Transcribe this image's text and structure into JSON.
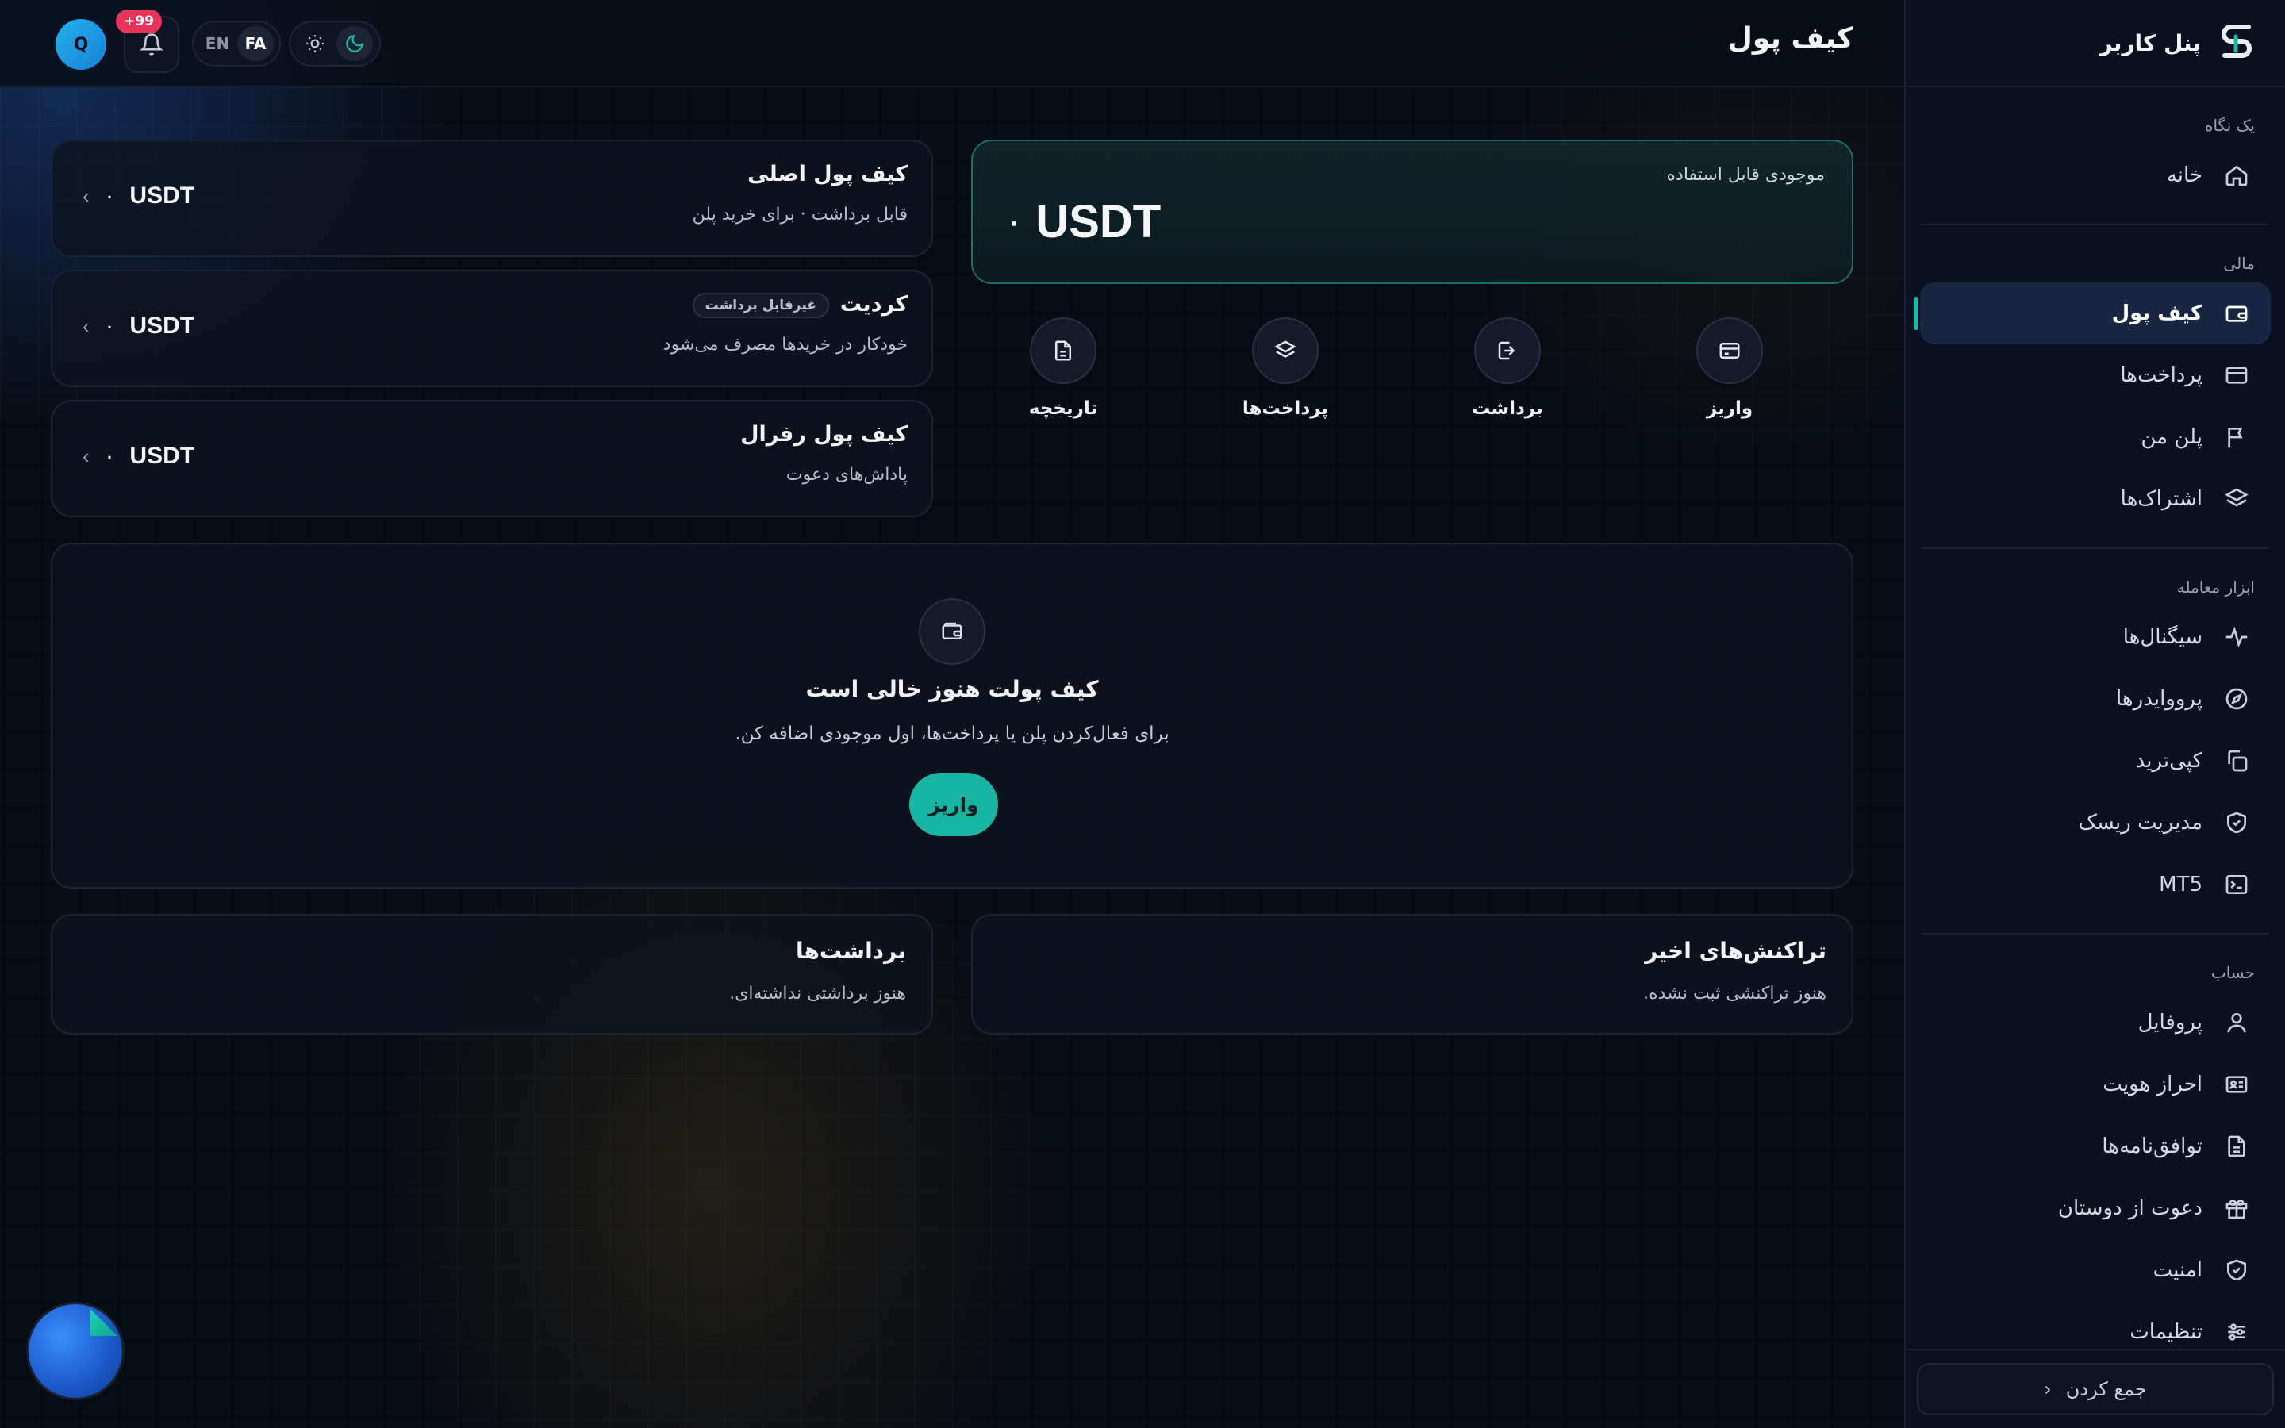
{
  "sidebar": {
    "title": "پنل کاربر",
    "sections": [
      {
        "label": "یک نگاه",
        "items": [
          {
            "label": "خانه",
            "icon": "home-icon"
          }
        ]
      },
      {
        "label": "مالی",
        "items": [
          {
            "label": "کیف پول",
            "icon": "wallet-icon",
            "active": true
          },
          {
            "label": "پرداخت‌ها",
            "icon": "credit-card-icon"
          },
          {
            "label": "پلن من",
            "icon": "flag-icon"
          },
          {
            "label": "اشتراک‌ها",
            "icon": "layers-icon"
          }
        ]
      },
      {
        "label": "ابزار معامله",
        "items": [
          {
            "label": "سیگنال‌ها",
            "icon": "activity-icon"
          },
          {
            "label": "پرووایدرها",
            "icon": "compass-icon"
          },
          {
            "label": "کپی‌ترید",
            "icon": "copy-icon"
          },
          {
            "label": "مدیریت ریسک",
            "icon": "shield-check-icon"
          },
          {
            "label": "MT5",
            "icon": "terminal-icon"
          }
        ]
      },
      {
        "label": "حساب",
        "items": [
          {
            "label": "پروفایل",
            "icon": "user-icon"
          },
          {
            "label": "احراز هویت",
            "icon": "id-card-icon"
          },
          {
            "label": "توافق‌نامه‌ها",
            "icon": "document-icon"
          },
          {
            "label": "دعوت از دوستان",
            "icon": "gift-icon"
          },
          {
            "label": "امنیت",
            "icon": "shield-icon"
          },
          {
            "label": "تنظیمات",
            "icon": "sliders-icon"
          }
        ]
      }
    ],
    "collapse_label": "جمع کردن"
  },
  "header": {
    "title": "کیف پول",
    "avatar_initial": "Q",
    "notifications_badge": "+99",
    "lang_active": "FA",
    "lang_inactive": "EN",
    "theme_active": "dark"
  },
  "balance": {
    "label": "موجودی قابل استفاده",
    "amount": "۰",
    "currency": "USDT"
  },
  "actions": [
    {
      "label": "واریز",
      "icon": "credit-card-icon"
    },
    {
      "label": "برداشت",
      "icon": "logout-icon"
    },
    {
      "label": "پرداخت‌ها",
      "icon": "layers-icon"
    },
    {
      "label": "تاریخچه",
      "icon": "document-icon"
    }
  ],
  "wallets": [
    {
      "title": "کیف پول اصلی",
      "subtitle": "قابل برداشت · برای خرید پلن",
      "amount": "۰",
      "currency": "USDT"
    },
    {
      "title": "کردیت",
      "badge": "غیرقابل برداشت",
      "subtitle": "خودکار در خریدها مصرف می‌شود",
      "amount": "۰",
      "currency": "USDT"
    },
    {
      "title": "کیف پول رفرال",
      "subtitle": "پاداش‌های دعوت",
      "amount": "۰",
      "currency": "USDT"
    }
  ],
  "empty_state": {
    "title": "کیف پولت هنوز خالی است",
    "subtitle": "برای فعال‌کردن پلن یا پرداخت‌ها، اول موجودی اضافه کن.",
    "button": "واریز"
  },
  "recent_transactions": {
    "title": "تراکنش‌های اخیر",
    "empty": "هنوز تراکنشی ثبت نشده."
  },
  "withdrawals": {
    "title": "برداشت‌ها",
    "empty": "هنوز برداشتی نداشته‌ای."
  },
  "colors": {
    "accent": "#18b5a3",
    "badge": "#e8345a",
    "background": "#070b14",
    "sidebar": "#0b1020"
  }
}
